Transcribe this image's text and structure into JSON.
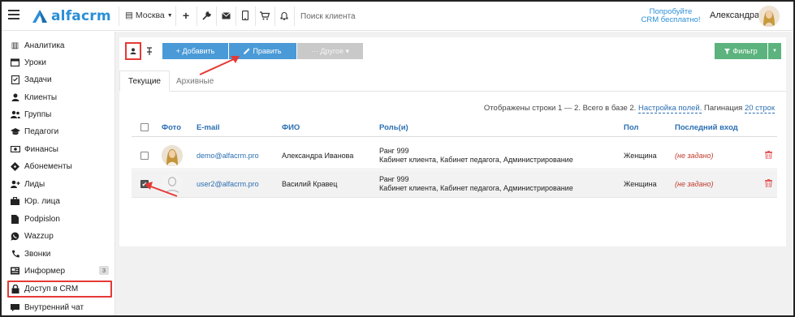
{
  "header": {
    "logo_text": "alfacrm",
    "branch": "Москва",
    "search_placeholder": "Поиск клиента",
    "promo_line1": "Попробуйте",
    "promo_line2": "CRM бесплатно!",
    "username": "Александра"
  },
  "sidebar": {
    "items": [
      {
        "label": "Аналитика",
        "icon": "chart-icon"
      },
      {
        "label": "Уроки",
        "icon": "calendar-icon"
      },
      {
        "label": "Задачи",
        "icon": "tasks-icon"
      },
      {
        "label": "Клиенты",
        "icon": "user-icon"
      },
      {
        "label": "Группы",
        "icon": "group-icon"
      },
      {
        "label": "Педагоги",
        "icon": "graduation-cap-icon"
      },
      {
        "label": "Финансы",
        "icon": "money-icon"
      },
      {
        "label": "Абонементы",
        "icon": "ticket-icon"
      },
      {
        "label": "Лиды",
        "icon": "user-plus-icon"
      },
      {
        "label": "Юр. лица",
        "icon": "briefcase-icon"
      },
      {
        "label": "Podpislon",
        "icon": "document-icon"
      },
      {
        "label": "Wazzup",
        "icon": "whatsapp-icon"
      },
      {
        "label": "Звонки",
        "icon": "phone-icon"
      },
      {
        "label": "Информер",
        "icon": "newspaper-icon",
        "badge": "3"
      },
      {
        "label": "Доступ в CRM",
        "icon": "lock-icon"
      },
      {
        "label": "Внутренний чат",
        "icon": "chat-icon"
      }
    ]
  },
  "toolbar": {
    "add_label": "+ Добавить",
    "edit_label": "Править",
    "other_label": "··· Другое ▾",
    "filter_label": "Фильтр"
  },
  "tabs": {
    "current": "Текущие",
    "archive": "Архивные"
  },
  "info": {
    "rows_text": "Отображены строки 1 — 2. Всего в базе 2.",
    "fields_link": "Настройка полей.",
    "pagination_label": "Пагинация",
    "pagination_value": "20 строк"
  },
  "table": {
    "headers": {
      "photo": "Фото",
      "email": "E-mail",
      "fio": "ФИО",
      "role": "Роль(и)",
      "gender": "Пол",
      "last_login": "Последний вход"
    },
    "rows": [
      {
        "email": "demo@alfacrm.pro",
        "fio": "Александра Иванова",
        "rank": "Ранг 999",
        "roles": "Кабинет клиента, Кабинет педагога, Администрирование",
        "gender": "Женщина",
        "last_login": "(не задано)",
        "checked": false
      },
      {
        "email": "user2@alfacrm.pro",
        "fio": "Василий Кравец",
        "rank": "Ранг 999",
        "roles": "Кабинет клиента, Кабинет педагога, Администрирование",
        "gender": "Женщина",
        "last_login": "(не задано)",
        "checked": true
      }
    ]
  },
  "colors": {
    "primary": "#4a9ad7",
    "success": "#5cb37d",
    "highlight": "#e53935",
    "link": "#2b6fb3"
  }
}
